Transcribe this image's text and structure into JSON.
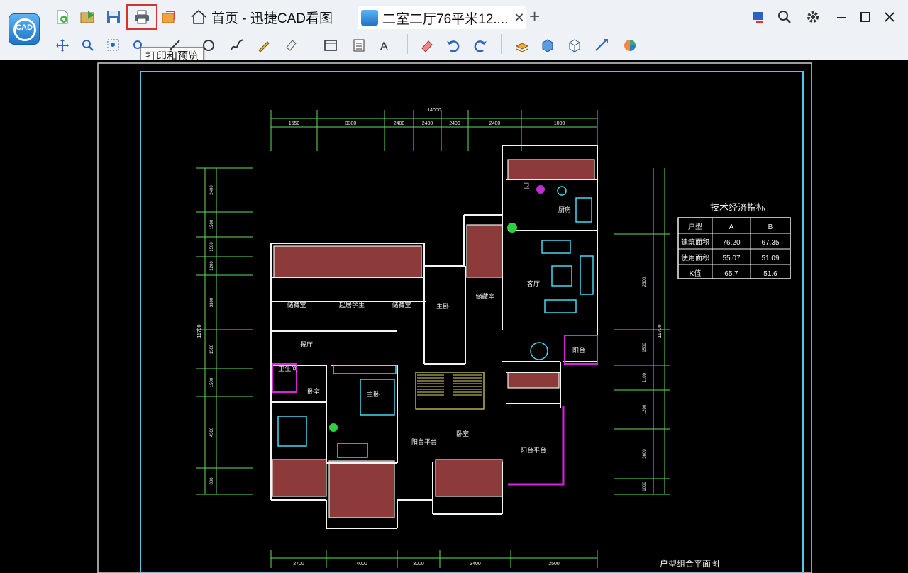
{
  "app": {
    "logo_text": "CAD"
  },
  "tabs": [
    {
      "label": "首页 - 迅捷CAD看图"
    },
    {
      "label": "二室二厅76平米12...."
    }
  ],
  "tooltip": {
    "text": "打印和预览"
  },
  "toolbar_top": {
    "icons": [
      "open-file-icon",
      "export-icon",
      "save-icon",
      "print-icon",
      "batch-print-icon"
    ]
  },
  "toolbar_bottom": {
    "icons": [
      "pan-icon",
      "zoom-window-icon",
      "zoom-extents-icon",
      "zoom-realtime-icon",
      "line-icon",
      "circle-icon",
      "polyline-icon",
      "pen-icon",
      "erase-icon",
      "frame-icon",
      "layer-list-icon",
      "text-icon",
      "eraser-icon",
      "undo-icon",
      "redo-icon",
      "layers-icon",
      "3d-box-icon",
      "3d-view-icon",
      "measure-icon",
      "color-wheel-icon"
    ]
  },
  "window_controls": {
    "icons": [
      "monitor-icon",
      "search-zoom-icon",
      "gear-icon",
      "minimize-icon",
      "maximize-icon",
      "close-icon"
    ]
  },
  "drawing": {
    "top_dims": [
      "1550",
      "3300",
      "2400",
      "2400",
      "2400",
      "2400",
      "1000"
    ],
    "top_total": "14000",
    "bottom_dims": [
      "2700",
      "4000",
      "3000",
      "3400",
      "2500"
    ],
    "left_dims": [
      "2400",
      "1500",
      "1500",
      "1200",
      "3300",
      "1500",
      "1500",
      "4500",
      "800"
    ],
    "left_total": "11700",
    "right_dims": [
      "2300",
      "1500",
      "1100",
      "1200",
      "3600",
      "1000"
    ],
    "right_total": "11700",
    "rooms": [
      "储藏室",
      "起居学生",
      "储藏室",
      "主卧",
      "储藏室",
      "客厅",
      "卫",
      "厨房",
      "阳台",
      "主卧",
      "卧室",
      "阳台平台",
      "卧室",
      "阳台平台",
      "卫生间",
      "餐厅"
    ],
    "table": {
      "title": "技术经济指标",
      "header": [
        "户型",
        "A",
        "B"
      ],
      "rows": [
        [
          "建筑面积",
          "76.20",
          "67.35"
        ],
        [
          "使用面积",
          "55.07",
          "51.09"
        ],
        [
          "K值",
          "65.7",
          "51.6"
        ]
      ]
    },
    "footer_title": "户型组合平面图"
  }
}
